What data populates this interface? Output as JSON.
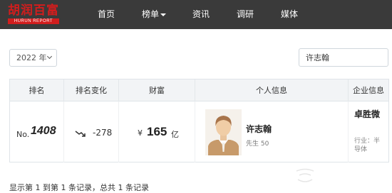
{
  "brand": {
    "logo_text": "胡润百富",
    "logo_subtext": "HURUN REPORT",
    "logo_color": "#d21d1d"
  },
  "nav": {
    "home": "首页",
    "rankings": "榜单",
    "news": "资讯",
    "research": "调研",
    "media": "媒体"
  },
  "filters": {
    "year_value": "2022 年",
    "search_value": "许志翰"
  },
  "table": {
    "headers": {
      "rank": "排名",
      "rank_change": "排名变化",
      "wealth": "财富",
      "personal_info": "个人信息",
      "company_info": "企业信息"
    },
    "row": {
      "rank_prefix": "No.",
      "rank": "1408",
      "rank_change": "-278",
      "trend_icon": "trend-down-icon",
      "currency": "¥",
      "wealth": "165",
      "wealth_unit": "亿",
      "name": "许志翰",
      "meta": "先生  50",
      "company": "卓胜微",
      "industry": "行业：半导体"
    }
  },
  "footer": {
    "records_text": "显示第 1 到第 1 条记录，总共 1 条记录"
  },
  "colors": {
    "navbar_bg": "#3a3a3a",
    "header_bg": "#f2f4f6"
  }
}
